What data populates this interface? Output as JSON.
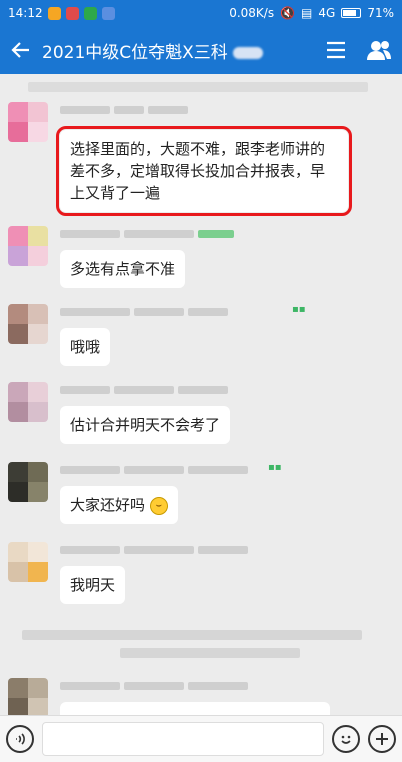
{
  "status": {
    "time": "14:12",
    "speed": "0.08K/s",
    "network": "4G",
    "battery": "71%"
  },
  "header": {
    "title": "2021中级C位夺魁X三科"
  },
  "messages": [
    {
      "text": "选择里面的，大题不难，跟李老师讲的差不多，定增取得长投加合并报表，早上又背了一遍"
    },
    {
      "text": "多选有点拿不准"
    },
    {
      "text": "哦哦"
    },
    {
      "text": "估计合并明天不会考了"
    },
    {
      "text": "大家还好吗"
    },
    {
      "text": "我明天"
    }
  ],
  "colors": {
    "primary": "#1a76d2",
    "highlight": "#e8191c",
    "tag": "#3db665"
  },
  "icons": {
    "voice": "voice-icon",
    "emoji": "emoji-icon",
    "add": "plus-icon"
  }
}
